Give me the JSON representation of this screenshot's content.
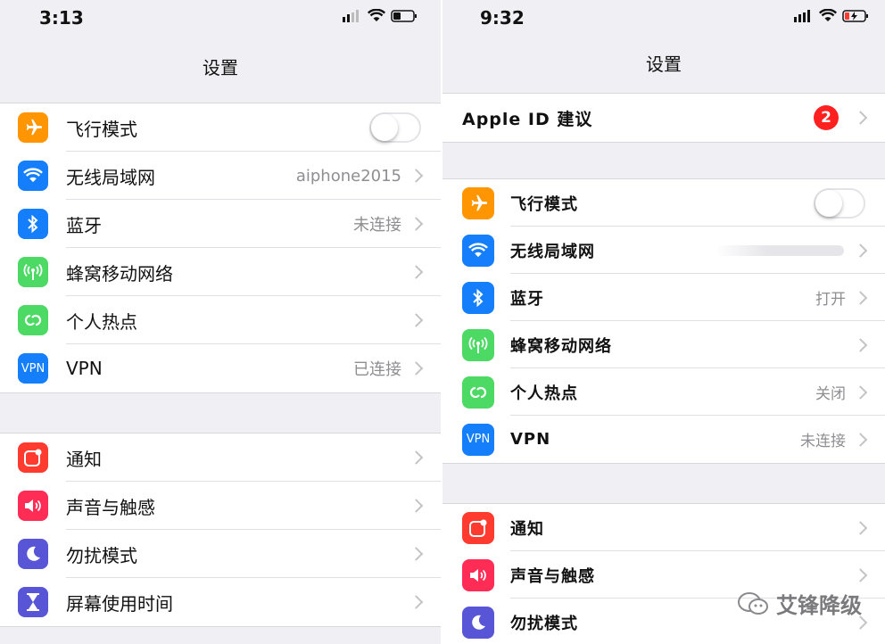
{
  "left": {
    "time": "3:13",
    "title": "设置",
    "group1": [
      {
        "label": "飞行模式",
        "icon": "airplane-icon",
        "color": "#ff9500",
        "type": "toggle",
        "on": false
      },
      {
        "label": "无线局域网",
        "icon": "wifi-icon",
        "color": "#147efb",
        "value": "aiphone2015"
      },
      {
        "label": "蓝牙",
        "icon": "bluetooth-icon",
        "color": "#147efb",
        "value": "未连接"
      },
      {
        "label": "蜂窝移动网络",
        "icon": "cellular-icon",
        "color": "#4cd964",
        "value": ""
      },
      {
        "label": "个人热点",
        "icon": "hotspot-icon",
        "color": "#4cd964",
        "value": ""
      },
      {
        "label": "VPN",
        "icon": "vpn-icon",
        "color": "#147efb",
        "icon_text": "VPN",
        "value": "已连接"
      }
    ],
    "group2": [
      {
        "label": "通知",
        "icon": "notifications-icon",
        "color": "#ff3b30"
      },
      {
        "label": "声音与触感",
        "icon": "sound-icon",
        "color": "#ff2d55"
      },
      {
        "label": "勿扰模式",
        "icon": "moon-icon",
        "color": "#5856d6"
      },
      {
        "label": "屏幕使用时间",
        "icon": "hourglass-icon",
        "color": "#5856d6"
      }
    ]
  },
  "right": {
    "time": "9:32",
    "title": "设置",
    "apple_id": {
      "label": "Apple ID 建议",
      "badge": "2"
    },
    "group1": [
      {
        "label": "飞行模式",
        "icon": "airplane-icon",
        "color": "#ff9500",
        "type": "toggle",
        "on": false
      },
      {
        "label": "无线局域网",
        "icon": "wifi-icon",
        "color": "#147efb",
        "value": ""
      },
      {
        "label": "蓝牙",
        "icon": "bluetooth-icon",
        "color": "#147efb",
        "value": "打开"
      },
      {
        "label": "蜂窝移动网络",
        "icon": "cellular-icon",
        "color": "#4cd964",
        "value": ""
      },
      {
        "label": "个人热点",
        "icon": "hotspot-icon",
        "color": "#4cd964",
        "value": "关闭"
      },
      {
        "label": "VPN",
        "icon": "vpn-icon",
        "color": "#147efb",
        "icon_text": "VPN",
        "value": "未连接"
      }
    ],
    "group2": [
      {
        "label": "通知",
        "icon": "notifications-icon",
        "color": "#ff3b30"
      },
      {
        "label": "声音与触感",
        "icon": "sound-icon",
        "color": "#ff2d55"
      },
      {
        "label": "勿扰模式",
        "icon": "moon-icon",
        "color": "#5856d6"
      }
    ]
  },
  "watermark": "艾锋降级"
}
